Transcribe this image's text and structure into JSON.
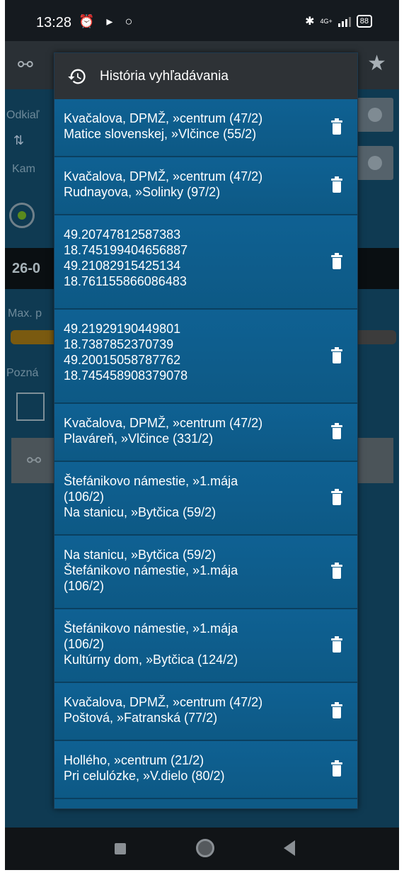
{
  "status_bar": {
    "time": "13:28",
    "network": "4G+",
    "battery": "88"
  },
  "background": {
    "from_label": "Odkiaľ",
    "to_label": "Kam",
    "date_value": "26-0",
    "max_label": "Max. p",
    "note_label": "Pozná",
    "bar_fraction": 0.14
  },
  "dialog": {
    "title": "História vyhľadávania",
    "icon": "history-icon",
    "items": [
      {
        "lines": [
          "Kvačalova, DPMŽ, »centrum (47/2)",
          "Matice slovenskej, »Vlčince (55/2)"
        ]
      },
      {
        "lines": [
          "Kvačalova, DPMŽ, »centrum (47/2)",
          "Rudnayova, »Solinky (97/2)"
        ]
      },
      {
        "lines": [
          "49.20747812587383",
          "18.745199404656887",
          "49.21082915425134",
          "18.761155866086483"
        ]
      },
      {
        "lines": [
          "49.21929190449801",
          "18.7387852370739",
          "49.20015058787762",
          "18.745458908379078"
        ]
      },
      {
        "lines": [
          "Kvačalova, DPMŽ, »centrum (47/2)",
          "Plaváreň, »Vlčince (331/2)"
        ]
      },
      {
        "lines": [
          "Štefánikovo námestie, »1.mája",
          "(106/2)",
          "Na stanicu, »Bytčica (59/2)"
        ]
      },
      {
        "lines": [
          "Na stanicu, »Bytčica (59/2)",
          "Štefánikovo námestie, »1.mája",
          "(106/2)"
        ]
      },
      {
        "lines": [
          "Štefánikovo námestie, »1.mája",
          "(106/2)",
          "Kultúrny dom, »Bytčica (124/2)"
        ]
      },
      {
        "lines": [
          "Kvačalova, DPMŽ, »centrum (47/2)",
          "Poštová, »Fatranská (77/2)"
        ]
      },
      {
        "lines": [
          "Hollého, »centrum (21/2)",
          "Pri celulózke, »V.dielo (80/2)"
        ]
      }
    ]
  }
}
